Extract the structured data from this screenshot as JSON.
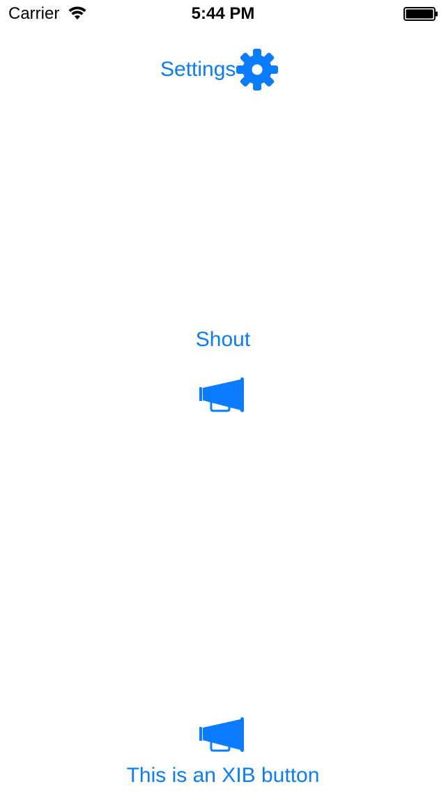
{
  "status_bar": {
    "carrier": "Carrier",
    "time": "5:44 PM",
    "wifi_icon": "wifi-icon",
    "battery_icon": "battery-full-icon"
  },
  "settings_button": {
    "label": "Settings",
    "icon": "gear-icon"
  },
  "shout_button": {
    "label": "Shout"
  },
  "megaphone_button": {
    "icon": "megaphone-icon"
  },
  "xib_button": {
    "label": "This is an XIB button",
    "icon": "megaphone-icon"
  },
  "colors": {
    "accent": "#0a7cff",
    "background": "#ffffff",
    "status_text": "#000000"
  }
}
